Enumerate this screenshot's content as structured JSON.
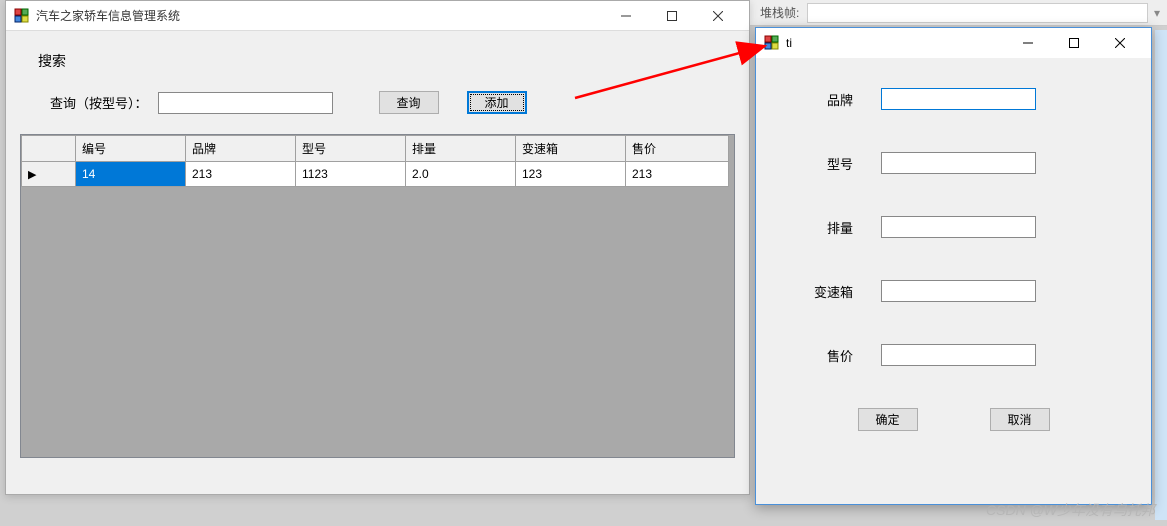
{
  "toolbar": {
    "stack_label": "堆栈帧:"
  },
  "main": {
    "title": "汽车之家轿车信息管理系统",
    "search_section": "搜索",
    "search_label": "查询（按型号）：",
    "search_value": "",
    "query_btn": "查询",
    "add_btn": "添加"
  },
  "grid": {
    "headers": [
      "编号",
      "品牌",
      "型号",
      "排量",
      "变速箱",
      "售价"
    ],
    "rows": [
      {
        "indicator": "▶",
        "cells": [
          "14",
          "213",
          "1123",
          "2.0",
          "123",
          "213"
        ],
        "selected_col": 0
      }
    ]
  },
  "dialog": {
    "title": "ti",
    "fields": [
      {
        "label": "品牌",
        "value": "",
        "focused": true
      },
      {
        "label": "型号",
        "value": "",
        "focused": false
      },
      {
        "label": "排量",
        "value": "",
        "focused": false
      },
      {
        "label": "变速箱",
        "value": "",
        "focused": false
      },
      {
        "label": "售价",
        "value": "",
        "focused": false
      }
    ],
    "ok_btn": "确定",
    "cancel_btn": "取消"
  },
  "watermark": "CSDN @W少年没有乌托邦"
}
